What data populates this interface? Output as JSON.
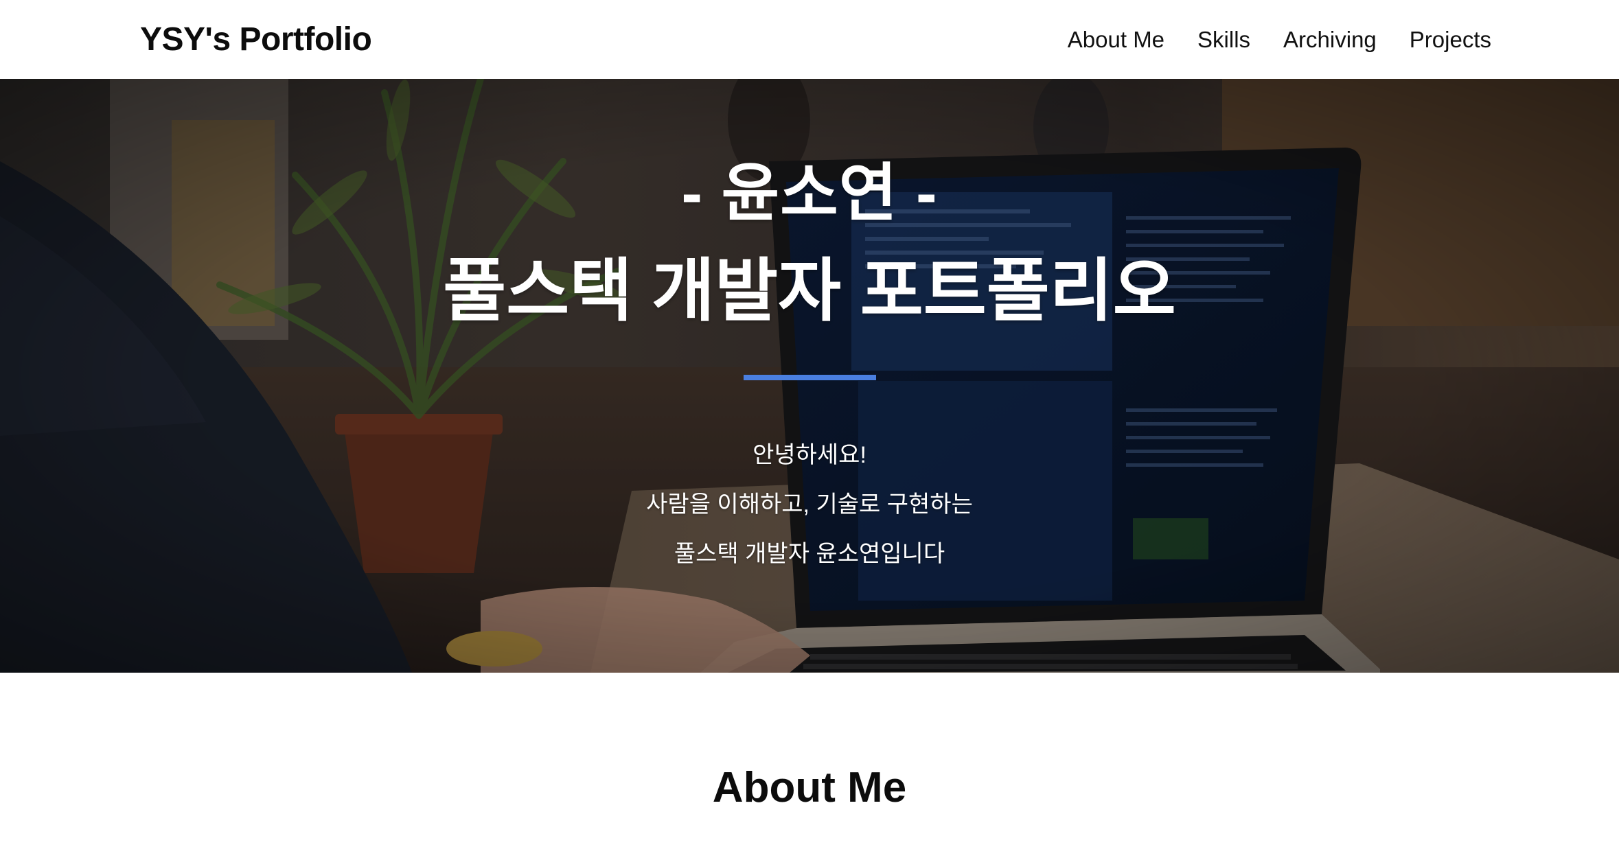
{
  "navbar": {
    "brand": "YSY's Portfolio",
    "links": [
      "About Me",
      "Skills",
      "Archiving",
      "Projects"
    ]
  },
  "hero": {
    "name": "- 윤소연 -",
    "title": "풀스택 개발자 포트폴리오",
    "lines": [
      "안녕하세요!",
      "사람을 이해하고, 기술로 구현하는",
      "풀스택 개발자 윤소연입니다"
    ],
    "background_image": "person typing on laptop with code editor, plant in pot",
    "accent_color": "#4a7fe0"
  },
  "about": {
    "title": "About Me"
  }
}
